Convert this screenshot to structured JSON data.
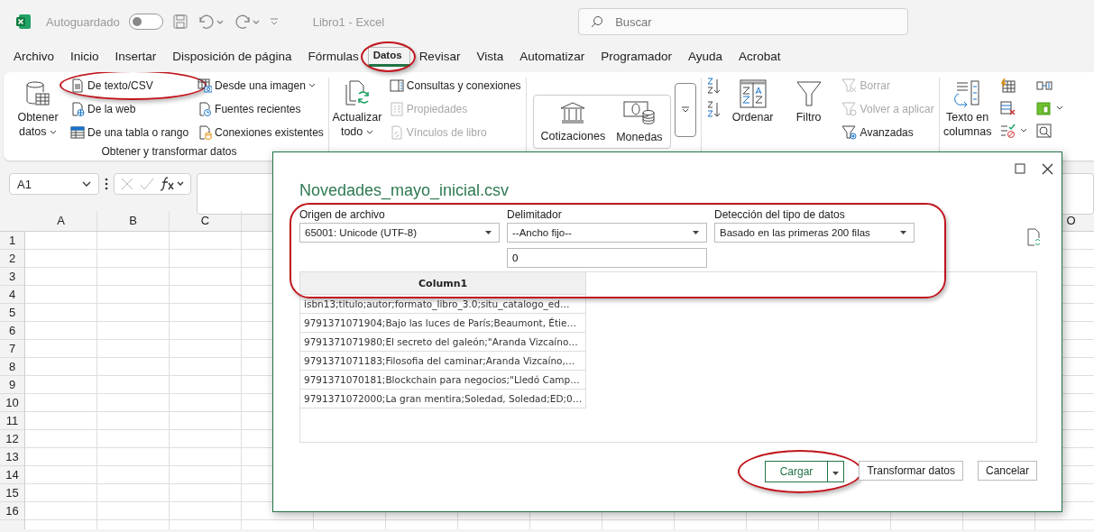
{
  "title_bar": {
    "autosave_label": "Autoguardado",
    "autosave_on": false,
    "document_title": "Libro1  -  Excel",
    "search": {
      "placeholder": "Buscar"
    }
  },
  "menu_tabs": [
    {
      "label": "Archivo",
      "selected": false,
      "highlighted": false
    },
    {
      "label": "Inicio",
      "selected": false,
      "highlighted": false
    },
    {
      "label": "Insertar",
      "selected": false,
      "highlighted": false
    },
    {
      "label": "Disposición de página",
      "selected": false,
      "highlighted": false
    },
    {
      "label": "Fórmulas",
      "selected": false,
      "highlighted": false
    },
    {
      "label": "Datos",
      "selected": true,
      "highlighted": true
    },
    {
      "label": "Revisar",
      "selected": false,
      "highlighted": false
    },
    {
      "label": "Vista",
      "selected": false,
      "highlighted": false
    },
    {
      "label": "Automatizar",
      "selected": false,
      "highlighted": false
    },
    {
      "label": "Programador",
      "selected": false,
      "highlighted": false
    },
    {
      "label": "Ayuda",
      "selected": false,
      "highlighted": false
    },
    {
      "label": "Acrobat",
      "selected": false,
      "highlighted": false
    }
  ],
  "ribbon": {
    "groups": [
      {
        "kind": "buttons",
        "label": "Obtener y transformar datos",
        "columns": [
          [
            {
              "kind": "large",
              "label": "Obtener datos",
              "menu": true
            }
          ],
          [
            {
              "kind": "small",
              "label": "De texto/CSV",
              "highlighted": true
            },
            {
              "kind": "small",
              "label": "De la web"
            },
            {
              "kind": "small",
              "label": "De una tabla o rango"
            }
          ],
          [
            {
              "kind": "small",
              "label": "Desde una imagen",
              "menu": true
            },
            {
              "kind": "small",
              "label": "Fuentes recientes"
            },
            {
              "kind": "small",
              "label": "Conexiones existentes"
            }
          ]
        ]
      },
      {
        "kind": "buttons",
        "columns": [
          [
            {
              "kind": "large",
              "label": "Actualizar todo",
              "menu": true
            }
          ],
          [
            {
              "kind": "small",
              "label": "Consultas y conexiones",
              "disabled": false
            },
            {
              "kind": "small",
              "label": "Propiedades",
              "disabled": true
            },
            {
              "kind": "small",
              "label": "Vínculos de libro",
              "disabled": true
            }
          ]
        ]
      },
      {
        "kind": "gallery",
        "tiles": [
          "Cotizaciones",
          "Monedas"
        ]
      },
      {
        "kind": "buttons",
        "columns": [
          [
            {
              "kind": "icon"
            },
            {
              "kind": "icon"
            }
          ],
          [
            {
              "kind": "large",
              "label": "Ordenar"
            }
          ],
          [
            {
              "kind": "large",
              "label": "Filtro"
            }
          ],
          [
            {
              "kind": "small",
              "label": "Borrar",
              "disabled": true
            },
            {
              "kind": "small",
              "label": "Volver a aplicar",
              "disabled": true
            },
            {
              "kind": "small",
              "label": "Avanzadas",
              "disabled": false
            }
          ]
        ]
      },
      {
        "kind": "buttons",
        "columns": [
          [
            {
              "kind": "large",
              "label": "Texto en columnas"
            }
          ],
          [
            {
              "kind": "icon"
            },
            {
              "kind": "icon"
            },
            {
              "kind": "icon",
              "menu": true
            }
          ],
          [
            {
              "kind": "icon"
            },
            {
              "kind": "icon",
              "menu": true
            },
            {
              "kind": "icon"
            }
          ]
        ]
      }
    ]
  },
  "formula_bar": {
    "name_box": "A1"
  },
  "sheet": {
    "columns_left": [
      "A",
      "B",
      "C"
    ],
    "columns_right": [
      "O"
    ],
    "rows": [
      "1",
      "2",
      "3",
      "4",
      "5",
      "6",
      "7",
      "8",
      "9",
      "10",
      "11",
      "12",
      "13",
      "14",
      "15",
      "16"
    ]
  },
  "dialog": {
    "title": "Novedades_mayo_inicial.csv",
    "options_highlighted": true,
    "file_origin": {
      "label": "Origen de archivo",
      "value": "65001: Unicode (UTF-8)"
    },
    "delimiter": {
      "label": "Delimitador",
      "value": "--Ancho fijo--",
      "width_value": "0"
    },
    "type_detection": {
      "label": "Detección del tipo de datos",
      "value": "Basado en las primeras 200 filas"
    },
    "preview": {
      "columns": [
        "Column1"
      ],
      "rows": [
        [
          "isbn13;titulo;autor;formato_libro_3.0;situ_catalogo_ed…"
        ],
        [
          "9791371071904;Bajo las luces de París;Beaumont, Étie…"
        ],
        [
          "9791371071980;El secreto del galeón;\"Aranda Vizcaíno…"
        ],
        [
          "9791371071183;Filosofia del caminar;Aranda Vizcaíno,…"
        ],
        [
          "9791371070181;Blockchain para negocios;\"Lledó Camp…"
        ],
        [
          "9791371072000;La gran mentira;Soledad, Soledad;ED;0…"
        ]
      ]
    },
    "buttons": [
      {
        "label": "Cargar",
        "kind": "split",
        "highlighted": true
      },
      {
        "label": "Transformar datos",
        "kind": "plain",
        "highlighted": false
      },
      {
        "label": "Cancelar",
        "kind": "plain",
        "highlighted": false
      }
    ]
  }
}
